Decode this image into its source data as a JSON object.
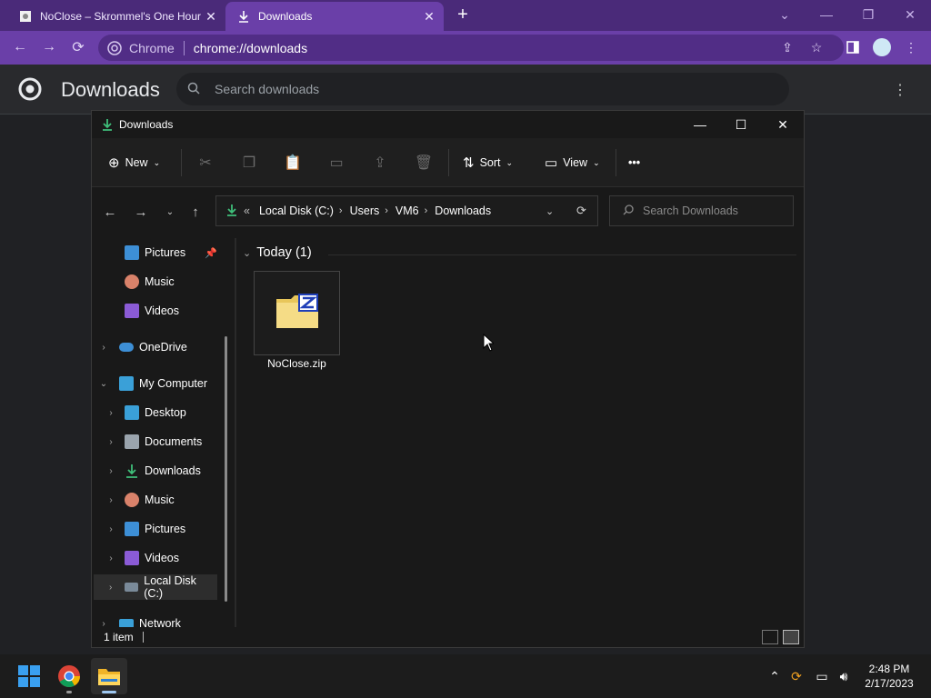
{
  "browser": {
    "tabs": [
      {
        "title": "NoClose – Skrommel's One Hour",
        "active": false
      },
      {
        "title": "Downloads",
        "active": true
      }
    ],
    "omnibox": {
      "site": "Chrome",
      "url": "chrome://downloads"
    }
  },
  "downloads_page": {
    "title": "Downloads",
    "search_placeholder": "Search downloads"
  },
  "explorer": {
    "title": "Downloads",
    "commands": {
      "new": "New",
      "sort": "Sort",
      "view": "View",
      "more": "•••"
    },
    "address": {
      "overflow": "«",
      "crumbs": [
        "Local Disk (C:)",
        "Users",
        "VM6",
        "Downloads"
      ]
    },
    "search_placeholder": "Search Downloads",
    "nav": {
      "pinned": [
        "Pictures",
        "Music",
        "Videos"
      ],
      "onedrive": "OneDrive",
      "computer": "My Computer",
      "computer_items": [
        "Desktop",
        "Documents",
        "Downloads",
        "Music",
        "Pictures",
        "Videos",
        "Local Disk (C:)"
      ],
      "network": "Network"
    },
    "group_label": "Today (1)",
    "files": [
      {
        "name": "NoClose.zip",
        "icon": "zip-folder-icon"
      }
    ],
    "status": "1 item"
  },
  "taskbar": {
    "apps": [
      "start-icon",
      "chrome-icon",
      "file-explorer-icon"
    ],
    "clock": {
      "time": "2:48 PM",
      "date": "2/17/2023"
    }
  },
  "colors": {
    "chrome_accent": "#6a3fa8",
    "chrome_frame": "#4a2a79",
    "explorer_bg": "#191919",
    "download_green": "#3fbf7a"
  }
}
